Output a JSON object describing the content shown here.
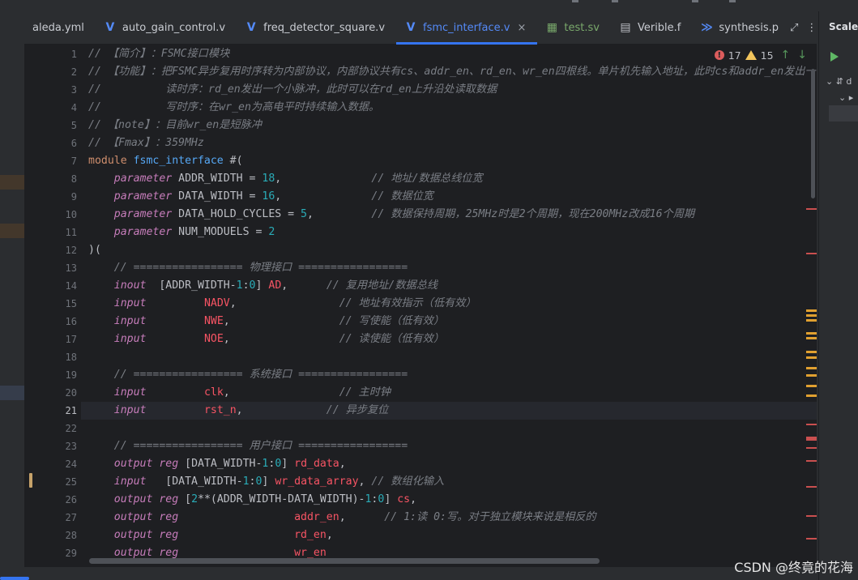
{
  "tabs": [
    {
      "label": "aleda.yml",
      "icon": "",
      "active": false,
      "kind": "yml"
    },
    {
      "label": "auto_gain_control.v",
      "icon": "V",
      "active": false,
      "kind": "v"
    },
    {
      "label": "freq_detector_square.v",
      "icon": "V",
      "active": false,
      "kind": "v"
    },
    {
      "label": "fsmc_interface.v",
      "icon": "V",
      "active": true,
      "kind": "v",
      "close": "×"
    },
    {
      "label": "test.sv",
      "icon": "▦",
      "active": false,
      "kind": "sv"
    },
    {
      "label": "Verible.f",
      "icon": "▤",
      "active": false,
      "kind": "f"
    },
    {
      "label": "synthesis.p",
      "icon": "≫",
      "active": false,
      "kind": "ps"
    }
  ],
  "tab_actions": {
    "expand": "⤢",
    "more": "⋮"
  },
  "inspection": {
    "errors": "17",
    "warnings": "15",
    "up": "↑",
    "down": "↓"
  },
  "right_panel": {
    "title": "Scaled",
    "tree_item_1": "⌄ ⇵ d",
    "tree_item_2": "⌄ ▸"
  },
  "current_line": 21,
  "lines": [
    [
      [
        "cm",
        "// 【简介】：FSMC接口模块"
      ]
    ],
    [
      [
        "cm",
        "// 【功能】：把FSMC异步复用时序转为内部协议，内部协议共有cs、addr_en、rd_en、wr_en四根线。单片机先输入地址，此时cs和addr_en发出一个"
      ]
    ],
    [
      [
        "cm",
        "//          读时序：rd_en发出一个小脉冲，此时可以在rd_en上升沿处读取数据"
      ]
    ],
    [
      [
        "cm",
        "//          写时序：在wr_en为高电平时持续输入数据。"
      ]
    ],
    [
      [
        "cm",
        "// 【note】：目前wr_en是短脉冲"
      ]
    ],
    [
      [
        "cm",
        "// 【Fmax】：359MHz"
      ]
    ],
    [
      [
        "kw",
        "module "
      ],
      [
        "mod",
        "fsmc_interface"
      ],
      [
        "pl",
        " #("
      ]
    ],
    [
      [
        "pl",
        "    "
      ],
      [
        "pm",
        "parameter"
      ],
      [
        "pl",
        " ADDR_WIDTH = "
      ],
      [
        "num",
        "18"
      ],
      [
        "pl",
        ",              "
      ],
      [
        "cm",
        "// 地址/数据总线位宽"
      ]
    ],
    [
      [
        "pl",
        "    "
      ],
      [
        "pm",
        "parameter"
      ],
      [
        "pl",
        " DATA_WIDTH = "
      ],
      [
        "num",
        "16"
      ],
      [
        "pl",
        ",              "
      ],
      [
        "cm",
        "// 数据位宽"
      ]
    ],
    [
      [
        "pl",
        "    "
      ],
      [
        "pm",
        "parameter"
      ],
      [
        "pl",
        " DATA_HOLD_CYCLES = "
      ],
      [
        "num",
        "5"
      ],
      [
        "pl",
        ",         "
      ],
      [
        "cm",
        "// 数据保持周期，25MHz时是2个周期，现在200MHz改成16个周期"
      ]
    ],
    [
      [
        "pl",
        "    "
      ],
      [
        "pm",
        "parameter"
      ],
      [
        "pl",
        " NUM_MODUELS = "
      ],
      [
        "num",
        "2"
      ]
    ],
    [
      [
        "pl",
        ")("
      ]
    ],
    [
      [
        "pl",
        "    "
      ],
      [
        "cm",
        "// ================= 物理接口 ================="
      ]
    ],
    [
      [
        "pl",
        "    "
      ],
      [
        "io",
        "inout"
      ],
      [
        "pl",
        "  [ADDR_WIDTH-"
      ],
      [
        "num",
        "1"
      ],
      [
        "pl",
        ":"
      ],
      [
        "num",
        "0"
      ],
      [
        "pl",
        "] "
      ],
      [
        "sig",
        "AD"
      ],
      [
        "pl",
        ",      "
      ],
      [
        "cm",
        "// 复用地址/数据总线"
      ]
    ],
    [
      [
        "pl",
        "    "
      ],
      [
        "io",
        "input"
      ],
      [
        "pl",
        "         "
      ],
      [
        "sig",
        "NADV"
      ],
      [
        "pl",
        ",                "
      ],
      [
        "cm",
        "// 地址有效指示（低有效）"
      ]
    ],
    [
      [
        "pl",
        "    "
      ],
      [
        "io",
        "input"
      ],
      [
        "pl",
        "         "
      ],
      [
        "sig",
        "NWE"
      ],
      [
        "pl",
        ",                 "
      ],
      [
        "cm",
        "// 写使能（低有效）"
      ]
    ],
    [
      [
        "pl",
        "    "
      ],
      [
        "io",
        "input"
      ],
      [
        "pl",
        "         "
      ],
      [
        "sig",
        "NOE"
      ],
      [
        "pl",
        ",                 "
      ],
      [
        "cm",
        "// 读使能（低有效）"
      ]
    ],
    [],
    [
      [
        "pl",
        "    "
      ],
      [
        "cm",
        "// ================= 系统接口 ================="
      ]
    ],
    [
      [
        "pl",
        "    "
      ],
      [
        "io",
        "input"
      ],
      [
        "pl",
        "         "
      ],
      [
        "sig",
        "clk"
      ],
      [
        "pl",
        ",                 "
      ],
      [
        "cm",
        "// 主时钟"
      ]
    ],
    [
      [
        "pl",
        "    "
      ],
      [
        "io",
        "input"
      ],
      [
        "pl",
        "         "
      ],
      [
        "sig",
        "rst_n"
      ],
      [
        "pl",
        ",             "
      ],
      [
        "cm",
        "// 异步复位"
      ]
    ],
    [],
    [
      [
        "pl",
        "    "
      ],
      [
        "cm",
        "// ================= 用户接口 ================="
      ]
    ],
    [
      [
        "pl",
        "    "
      ],
      [
        "io",
        "output"
      ],
      [
        "pl",
        " "
      ],
      [
        "io",
        "reg"
      ],
      [
        "pl",
        " [DATA_WIDTH-"
      ],
      [
        "num",
        "1"
      ],
      [
        "pl",
        ":"
      ],
      [
        "num",
        "0"
      ],
      [
        "pl",
        "] "
      ],
      [
        "sig",
        "rd_data"
      ],
      [
        "pl",
        ","
      ]
    ],
    [
      [
        "pl",
        "    "
      ],
      [
        "io",
        "input"
      ],
      [
        "pl",
        "   [DATA_WIDTH-"
      ],
      [
        "num",
        "1"
      ],
      [
        "pl",
        ":"
      ],
      [
        "num",
        "0"
      ],
      [
        "pl",
        "] "
      ],
      [
        "sig",
        "wr_data_array"
      ],
      [
        "pl",
        ", "
      ],
      [
        "cm",
        "// 数组化输入"
      ]
    ],
    [
      [
        "pl",
        "    "
      ],
      [
        "io",
        "output"
      ],
      [
        "pl",
        " "
      ],
      [
        "io",
        "reg"
      ],
      [
        "pl",
        " ["
      ],
      [
        "num",
        "2"
      ],
      [
        "pl",
        "**(ADDR_WIDTH-DATA_WIDTH)-"
      ],
      [
        "num",
        "1"
      ],
      [
        "pl",
        ":"
      ],
      [
        "num",
        "0"
      ],
      [
        "pl",
        "] "
      ],
      [
        "sig",
        "cs"
      ],
      [
        "pl",
        ","
      ]
    ],
    [
      [
        "pl",
        "    "
      ],
      [
        "io",
        "output"
      ],
      [
        "pl",
        " "
      ],
      [
        "io",
        "reg"
      ],
      [
        "pl",
        "                  "
      ],
      [
        "sig",
        "addr_en"
      ],
      [
        "pl",
        ",      "
      ],
      [
        "cm",
        "// 1:读 0:写。对于独立模块来说是相反的"
      ]
    ],
    [
      [
        "pl",
        "    "
      ],
      [
        "io",
        "output"
      ],
      [
        "pl",
        " "
      ],
      [
        "io",
        "reg"
      ],
      [
        "pl",
        "                  "
      ],
      [
        "sig",
        "rd_en"
      ],
      [
        "pl",
        ","
      ]
    ],
    [
      [
        "pl",
        "    "
      ],
      [
        "io",
        "output"
      ],
      [
        "pl",
        " "
      ],
      [
        "io",
        "reg"
      ],
      [
        "pl",
        "                  "
      ],
      [
        "sig",
        "wr_en"
      ]
    ]
  ],
  "watermark": "CSDN @终竟的花海"
}
